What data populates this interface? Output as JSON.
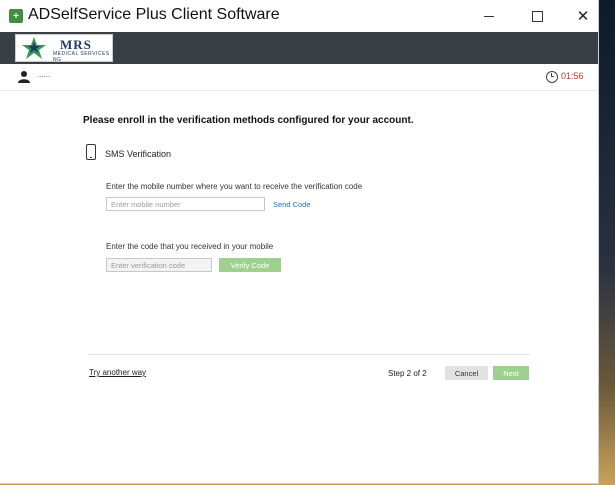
{
  "window": {
    "title": "ADSelfService Plus Client Software",
    "icon": "adselfservice-app-icon",
    "app_icon_glyph": "+",
    "close_glyph": "✕"
  },
  "brand": {
    "logo_text": "MRS",
    "logo_subtext": "MEDICAL SERVICES NG",
    "logo_colors": {
      "star": "#2e9b5a",
      "text": "#1d3a63"
    },
    "bar_color": "#3a3f44"
  },
  "session": {
    "user_name": "......",
    "timer": "01:56",
    "timer_color": "#c0392b"
  },
  "enroll": {
    "heading": "Please enroll in the verification methods configured for your account.",
    "method_label": "SMS Verification",
    "mobile_instruction": "Enter the mobile number where you want to receive the verification code",
    "mobile_placeholder": "Enter mobile number",
    "send_code_label": "Send Code",
    "code_instruction": "Enter the code that you received in your mobile",
    "code_placeholder": "Enter verification code",
    "verify_label": "Verify Code"
  },
  "footer": {
    "try_another_label": "Try another way",
    "step_text": "Step 2 of 2",
    "cancel_label": "Cancel",
    "next_label": "Next"
  },
  "colors": {
    "accent_green": "#9fd18e",
    "link_blue": "#1f6fb2"
  }
}
